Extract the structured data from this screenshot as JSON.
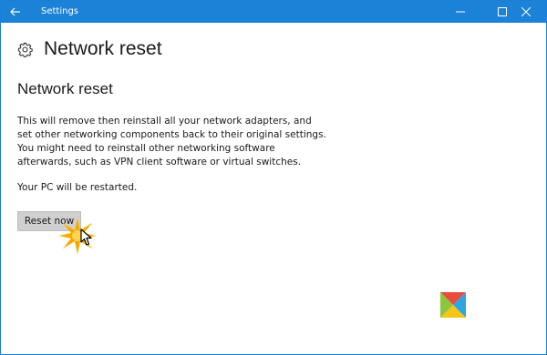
{
  "window": {
    "title": "Settings",
    "titlebar_color": "#1b82d8"
  },
  "header": {
    "title": "Network reset",
    "icon": "gear-icon"
  },
  "section": {
    "title": "Network reset",
    "description": "This will remove then reinstall all your network adapters, and set other networking components back to their original settings. You might need to reinstall other networking software afterwards, such as VPN client software or virtual switches.",
    "restart_note": "Your PC will be restarted.",
    "reset_button_label": "Reset now"
  },
  "icons": {
    "back": "back-arrow-icon",
    "minimize": "minimize-icon",
    "maximize": "maximize-icon",
    "close": "close-icon",
    "cursor": "mouse-cursor-icon",
    "click_effect": "click-burst-icon",
    "logo": "colored-square-logo-icon"
  },
  "logo_colors": [
    "#e84c3d",
    "#2aa7e0",
    "#f5c518",
    "#8cc63f"
  ]
}
